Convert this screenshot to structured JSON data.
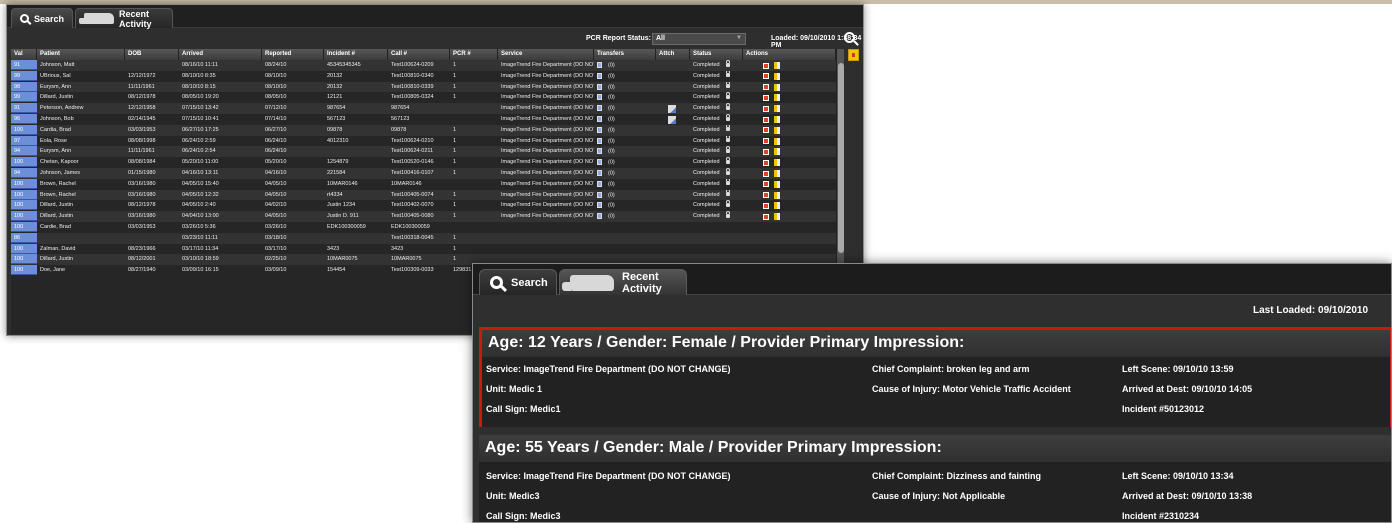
{
  "window1": {
    "tabs": {
      "search": "Search",
      "recent": "Recent Activity"
    },
    "filter": {
      "label": "PCR Report Status:",
      "value": "All",
      "loaded": "Loaded: 09/10/2010 1:38:34 PM"
    },
    "columns": [
      "Val",
      "Patient",
      "DOB",
      "Arrived",
      "Reported",
      "Incident #",
      "Call #",
      "PCR #",
      "Service",
      "Transfers",
      "Attch",
      "Status",
      "Actions"
    ],
    "rows": [
      {
        "val": "91",
        "patient": "Johnson, Matt",
        "dob": "",
        "arrived": "08/16/10 11:11",
        "reported": "08/24/10",
        "incident": "45345345345",
        "call": "Test100624-0209",
        "pcr": "1",
        "service": "ImageTrend Fire Department (DO NOT",
        "transfers": "(0)",
        "attach": "",
        "status": "Completed"
      },
      {
        "val": "99",
        "patient": "UBrious, Sal",
        "dob": "12/12/1972",
        "arrived": "08/10/10 8:35",
        "reported": "08/10/10",
        "incident": "20132",
        "call": "Test100810-0340",
        "pcr": "1",
        "service": "ImageTrend Fire Department (DO NOT",
        "transfers": "(0)",
        "attach": "",
        "status": "Completed"
      },
      {
        "val": "98",
        "patient": "Eurysm, Ann",
        "dob": "11/11/1961",
        "arrived": "08/10/10 8:15",
        "reported": "08/10/10",
        "incident": "20132",
        "call": "Test100810-0339",
        "pcr": "1",
        "service": "ImageTrend Fire Department (DO NOT",
        "transfers": "(0)",
        "attach": "",
        "status": "Completed"
      },
      {
        "val": "99",
        "patient": "Dillard, Justin",
        "dob": "08/12/1978",
        "arrived": "08/05/10 19:20",
        "reported": "08/05/10",
        "incident": "12121",
        "call": "Test100805-0324",
        "pcr": "1",
        "service": "ImageTrend Fire Department (DO NOT",
        "transfers": "(0)",
        "attach": "",
        "status": "Completed"
      },
      {
        "val": "91",
        "patient": "Peterson, Andrew",
        "dob": "12/12/1958",
        "arrived": "07/15/10 13:42",
        "reported": "07/12/10",
        "incident": "987654",
        "call": "987654",
        "pcr": "",
        "service": "ImageTrend Fire Department (DO NOT",
        "transfers": "(0)",
        "attach": "yes",
        "status": "Completed"
      },
      {
        "val": "96",
        "patient": "Johnson, Bob",
        "dob": "02/14/1945",
        "arrived": "07/15/10 10:41",
        "reported": "07/14/10",
        "incident": "567123",
        "call": "567123",
        "pcr": "",
        "service": "ImageTrend Fire Department (DO NOT",
        "transfers": "(0)",
        "attach": "yes",
        "status": "Completed"
      },
      {
        "val": "100",
        "patient": "Cardia, Brad",
        "dob": "03/03/1953",
        "arrived": "06/27/10 17:25",
        "reported": "06/27/10",
        "incident": "09878",
        "call": "09878",
        "pcr": "1",
        "service": "ImageTrend Fire Department (DO NOT",
        "transfers": "(0)",
        "attach": "",
        "status": "Completed"
      },
      {
        "val": "97",
        "patient": "Eola, Rose",
        "dob": "08/08/1998",
        "arrived": "06/24/10 2:59",
        "reported": "06/24/10",
        "incident": "4012310",
        "call": "Test100624-0210",
        "pcr": "1",
        "service": "ImageTrend Fire Department (DO NOT",
        "transfers": "(0)",
        "attach": "",
        "status": "Completed"
      },
      {
        "val": "94",
        "patient": "Eurysm, Ann",
        "dob": "11/11/1961",
        "arrived": "06/24/10 2:54",
        "reported": "06/24/10",
        "incident": "",
        "call": "Test100624-0211",
        "pcr": "1",
        "service": "ImageTrend Fire Department (DO NOT",
        "transfers": "(0)",
        "attach": "",
        "status": "Completed"
      },
      {
        "val": "100",
        "patient": "Chetan, Kapoor",
        "dob": "08/08/1984",
        "arrived": "05/20/10 11:00",
        "reported": "05/20/10",
        "incident": "1254879",
        "call": "Test100520-0146",
        "pcr": "1",
        "service": "ImageTrend Fire Department (DO NOT",
        "transfers": "(0)",
        "attach": "",
        "status": "Completed"
      },
      {
        "val": "94",
        "patient": "Johnson, James",
        "dob": "01/15/1980",
        "arrived": "04/16/10 13:11",
        "reported": "04/16/10",
        "incident": "221584",
        "call": "Test100416-0107",
        "pcr": "1",
        "service": "ImageTrend Fire Department (DO NOT",
        "transfers": "(0)",
        "attach": "",
        "status": "Completed"
      },
      {
        "val": "100",
        "patient": "Brown, Rachel",
        "dob": "03/16/1980",
        "arrived": "04/05/10 15:40",
        "reported": "04/05/10",
        "incident": "10MAR0146",
        "call": "10MAR0146",
        "pcr": "",
        "service": "ImageTrend Fire Department (DO NOT",
        "transfers": "(0)",
        "attach": "",
        "status": "Completed"
      },
      {
        "val": "100",
        "patient": "Brown, Rachel",
        "dob": "03/16/1980",
        "arrived": "04/05/10 12:32",
        "reported": "04/05/10",
        "incident": "rt4334",
        "call": "Test100405-0074",
        "pcr": "1",
        "service": "ImageTrend Fire Department (DO NOT",
        "transfers": "(0)",
        "attach": "",
        "status": "Completed"
      },
      {
        "val": "100",
        "patient": "Dillard, Justin",
        "dob": "08/12/1978",
        "arrived": "04/05/10 2:40",
        "reported": "04/02/10",
        "incident": "Justin 1234",
        "call": "Test100402-0070",
        "pcr": "1",
        "service": "ImageTrend Fire Department (DO NOT",
        "transfers": "(0)",
        "attach": "",
        "status": "Completed"
      },
      {
        "val": "100",
        "patient": "Dillard, Justin",
        "dob": "03/16/1980",
        "arrived": "04/04/10 13:00",
        "reported": "04/05/10",
        "incident": "Justin D. 911",
        "call": "Test100405-0080",
        "pcr": "1",
        "service": "ImageTrend Fire Department (DO NOT",
        "transfers": "(0)",
        "attach": "",
        "status": "Completed"
      },
      {
        "val": "100",
        "patient": "Cardie, Brad",
        "dob": "03/03/1953",
        "arrived": "03/26/10 5:36",
        "reported": "03/26/10",
        "incident": "EDK100300059",
        "call": "EDK100300059",
        "pcr": "",
        "service": "",
        "transfers": "",
        "attach": "",
        "status": ""
      },
      {
        "val": "86",
        "patient": "",
        "dob": "",
        "arrived": "03/23/10 11:11",
        "reported": "03/18/10",
        "incident": "",
        "call": "Test100318-0045",
        "pcr": "1",
        "service": "",
        "transfers": "",
        "attach": "",
        "status": ""
      },
      {
        "val": "100",
        "patient": "Zalman, David",
        "dob": "08/23/1966",
        "arrived": "03/17/10 11:34",
        "reported": "03/17/10",
        "incident": "3423",
        "call": "3423",
        "pcr": "1",
        "service": "",
        "transfers": "",
        "attach": "",
        "status": ""
      },
      {
        "val": "100",
        "patient": "Dillard, Justin",
        "dob": "08/12/2001",
        "arrived": "03/10/10 18:59",
        "reported": "02/25/10",
        "incident": "10MAR0075",
        "call": "10MAR0075",
        "pcr": "1",
        "service": "",
        "transfers": "",
        "attach": "",
        "status": ""
      },
      {
        "val": "100",
        "patient": "Doe, Jane",
        "dob": "08/27/1940",
        "arrived": "03/09/10 16:15",
        "reported": "03/09/10",
        "incident": "154454",
        "call": "Test100309-0033",
        "pcr": "129831",
        "service": "",
        "transfers": "",
        "attach": "",
        "status": ""
      }
    ]
  },
  "window2": {
    "tabs": {
      "search": "Search",
      "recent": "Recent Activity"
    },
    "loaded": "Last Loaded: 09/10/2010",
    "cards": [
      {
        "title": "Age: 12 Years / Gender: Female / Provider Primary Impression:",
        "service": "Service: ImageTrend Fire Department (DO NOT CHANGE)",
        "unit": "Unit: Medic 1",
        "call_sign": "Call Sign: Medic1",
        "chief_complaint": "Chief Complaint: broken leg and arm",
        "cause": "Cause of Injury: Motor Vehicle Traffic Accident",
        "left_scene": "Left Scene: 09/10/10 13:59",
        "arrived_dest": "Arrived at Dest: 09/10/10 14:05",
        "incident": "Incident #50123012"
      },
      {
        "title": "Age: 55 Years / Gender: Male / Provider Primary Impression:",
        "service": "Service: ImageTrend Fire Department (DO NOT CHANGE)",
        "unit": "Unit: Medic3",
        "call_sign": "Call Sign: Medic3",
        "chief_complaint": "Chief Complaint: Dizziness and fainting",
        "cause": "Cause of Injury: Not Applicable",
        "left_scene": "Left Scene: 09/10/10 13:34",
        "arrived_dest": "Arrived at Dest: 09/10/10 13:38",
        "incident": "Incident #2310234"
      }
    ]
  }
}
